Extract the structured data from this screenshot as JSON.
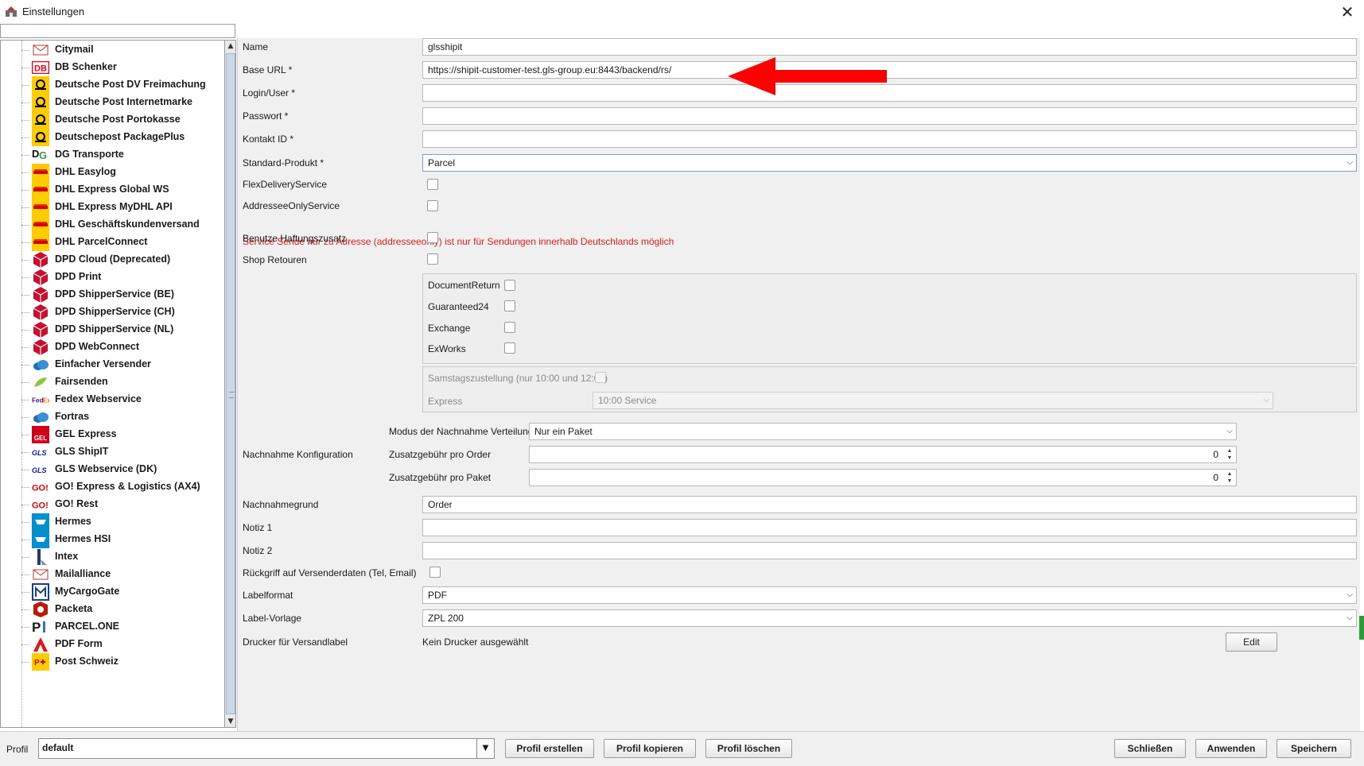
{
  "window": {
    "title": "Einstellungen"
  },
  "tree": {
    "items": [
      {
        "label": "Citymail",
        "icon": "envelope-icon"
      },
      {
        "label": "DB Schenker",
        "icon": "db-logo-icon"
      },
      {
        "label": "Deutsche Post DV Freimachung",
        "icon": "post-horn-icon"
      },
      {
        "label": "Deutsche Post Internetmarke",
        "icon": "post-horn-icon"
      },
      {
        "label": "Deutsche Post Portokasse",
        "icon": "post-horn-icon"
      },
      {
        "label": "Deutschepost PackagePlus",
        "icon": "post-horn-icon"
      },
      {
        "label": "DG Transporte",
        "icon": "dg-logo-icon"
      },
      {
        "label": "DHL Easylog",
        "icon": "dhl-icon"
      },
      {
        "label": "DHL Express Global WS",
        "icon": "dhl-icon"
      },
      {
        "label": "DHL Express MyDHL API",
        "icon": "dhl-icon"
      },
      {
        "label": "DHL Geschäftskundenversand",
        "icon": "dhl-icon"
      },
      {
        "label": "DHL ParcelConnect",
        "icon": "dhl-icon"
      },
      {
        "label": "DPD Cloud (Deprecated)",
        "icon": "dpd-cube-icon"
      },
      {
        "label": "DPD Print",
        "icon": "dpd-cube-icon"
      },
      {
        "label": "DPD ShipperService (BE)",
        "icon": "dpd-cube-icon"
      },
      {
        "label": "DPD ShipperService (CH)",
        "icon": "dpd-cube-icon"
      },
      {
        "label": "DPD ShipperService (NL)",
        "icon": "dpd-cube-icon"
      },
      {
        "label": "DPD WebConnect",
        "icon": "dpd-cube-icon"
      },
      {
        "label": "Einfacher Versender",
        "icon": "cloud-icon"
      },
      {
        "label": "Fairsenden",
        "icon": "leaf-icon"
      },
      {
        "label": "Fedex Webservice",
        "icon": "fedex-icon"
      },
      {
        "label": "Fortras",
        "icon": "cloud-icon"
      },
      {
        "label": "GEL Express",
        "icon": "gel-icon"
      },
      {
        "label": "GLS ShipIT",
        "icon": "gls-icon"
      },
      {
        "label": "GLS Webservice (DK)",
        "icon": "gls-icon"
      },
      {
        "label": "GO! Express & Logistics (AX4)",
        "icon": "go-icon"
      },
      {
        "label": "GO! Rest",
        "icon": "go-icon"
      },
      {
        "label": "Hermes",
        "icon": "hermes-icon"
      },
      {
        "label": "Hermes HSI",
        "icon": "hermes-icon"
      },
      {
        "label": "Intex",
        "icon": "intex-icon"
      },
      {
        "label": "Mailalliance",
        "icon": "envelope-icon"
      },
      {
        "label": "MyCargoGate",
        "icon": "mycargogate-icon"
      },
      {
        "label": "Packeta",
        "icon": "packeta-icon"
      },
      {
        "label": "PARCEL.ONE",
        "icon": "parcelone-icon"
      },
      {
        "label": "PDF Form",
        "icon": "pdf-icon"
      },
      {
        "label": "Post Schweiz",
        "icon": "post-schweiz-icon"
      }
    ]
  },
  "form": {
    "name": {
      "label": "Name",
      "value": "glsshipit"
    },
    "base_url": {
      "label": "Base URL *",
      "value": "https://shipit-customer-test.gls-group.eu:8443/backend/rs/"
    },
    "login": {
      "label": "Login/User *",
      "value": ""
    },
    "password": {
      "label": "Passwort *",
      "value": ""
    },
    "contact_id": {
      "label": "Kontakt ID *",
      "value": ""
    },
    "standard_product": {
      "label": "Standard-Produkt *",
      "value": "Parcel"
    },
    "flex_delivery": {
      "label": "FlexDeliveryService"
    },
    "addressee_only": {
      "label": "AddresseeOnlyService"
    },
    "error_message": "Service Sende nur zu Adresse (addresseeonly) ist nur für Sendungen innerhalb Deutschlands möglich",
    "liability": {
      "label": "Benutze Haftungszusatz"
    },
    "shop_returns": {
      "label": "Shop Retouren"
    },
    "services": [
      {
        "label": "DocumentReturn"
      },
      {
        "label": "Guaranteed24"
      },
      {
        "label": "Exchange"
      },
      {
        "label": "ExWorks"
      }
    ],
    "saturday": {
      "label": "Samstagszustellung (nur 10:00 und 12:00)"
    },
    "express": {
      "label": "Express",
      "value": "10:00 Service"
    },
    "cod": {
      "section_label": "Nachnahme Konfiguration",
      "mode_label": "Modus der Nachnahme Verteilung",
      "mode_value": "Nur ein Paket",
      "fee_order_label": "Zusatzgebühr pro Order",
      "fee_order_value": "0",
      "fee_package_label": "Zusatzgebühr pro Paket",
      "fee_package_value": "0"
    },
    "cod_reason": {
      "label": "Nachnahmegrund",
      "value": "Order"
    },
    "note1": {
      "label": "Notiz 1",
      "value": ""
    },
    "note2": {
      "label": "Notiz 2",
      "value": ""
    },
    "sender_data": {
      "label": "Rückgriff auf Versenderdaten (Tel, Email)"
    },
    "label_format": {
      "label": "Labelformat",
      "value": "PDF"
    },
    "label_template": {
      "label": "Label-Vorlage",
      "value": "ZPL 200"
    },
    "printer": {
      "label": "Drucker für Versandlabel",
      "value": "Kein Drucker ausgewählt",
      "edit_label": "Edit"
    }
  },
  "bottom": {
    "profile_label": "Profil",
    "profile_value": "default",
    "create_label": "Profil erstellen",
    "copy_label": "Profil kopieren",
    "delete_label": "Profil löschen",
    "close_label": "Schließen",
    "apply_label": "Anwenden",
    "save_label": "Speichern"
  },
  "colors": {
    "annotation_arrow": "#ff0000",
    "error_text": "#e02020",
    "dpd_red": "#c8102e",
    "dhl_yellow": "#ffcc00",
    "gls_blue": "#061ab1"
  }
}
